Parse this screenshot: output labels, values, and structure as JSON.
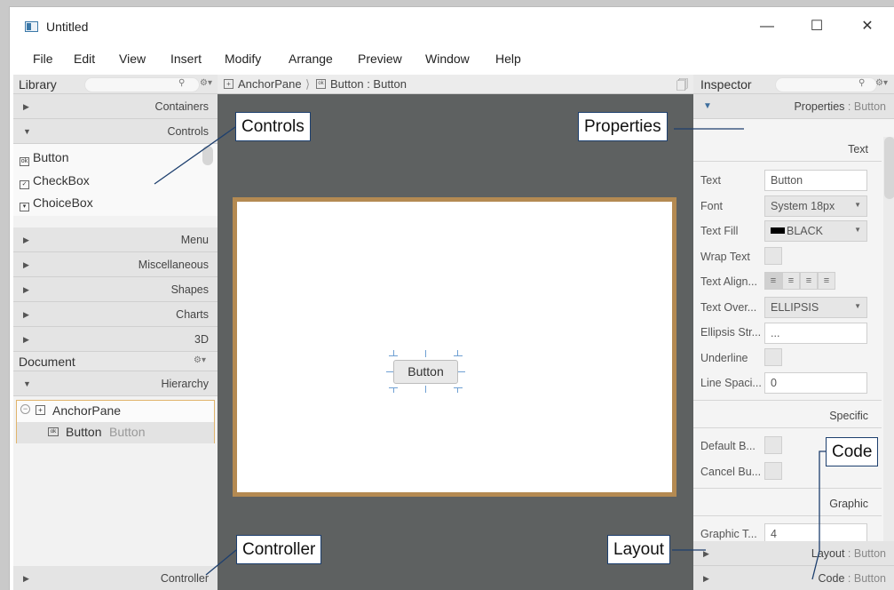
{
  "window": {
    "title": "Untitled",
    "controls": {
      "minimize": "—",
      "maximize": "☐",
      "close": "✕"
    }
  },
  "menu": [
    "File",
    "Edit",
    "View",
    "Insert",
    "Modify",
    "Arrange",
    "Preview",
    "Window",
    "Help"
  ],
  "library": {
    "title": "Library",
    "search_icon": "search-icon",
    "sections": [
      "Containers",
      "Controls",
      "Menu",
      "Miscellaneous",
      "Shapes",
      "Charts",
      "3D"
    ],
    "controls_items": [
      "Button",
      "CheckBox",
      "ChoiceBox"
    ]
  },
  "document": {
    "title": "Document",
    "hierarchy_label": "Hierarchy",
    "tree": [
      {
        "label": "AnchorPane",
        "sub": ""
      },
      {
        "label": "Button",
        "sub": "Button"
      }
    ],
    "controller_label": "Controller"
  },
  "breadcrumb": {
    "parent": "AnchorPane",
    "child": "Button : Button"
  },
  "canvas": {
    "button_label": "Button"
  },
  "inspector": {
    "title": "Inspector",
    "properties_label": "Properties",
    "properties_sub": ": Button",
    "section_text": "Text",
    "section_specific": "Specific",
    "section_graphic": "Graphic",
    "props": {
      "text_label": "Text",
      "text_value": "Button",
      "font_label": "Font",
      "font_value": "System 18px",
      "fill_label": "Text Fill",
      "fill_value": "BLACK",
      "wrap_label": "Wrap Text",
      "align_label": "Text Align...",
      "overrun_label": "Text Over...",
      "overrun_value": "ELLIPSIS",
      "ellipsis_label": "Ellipsis Str...",
      "ellipsis_value": "...",
      "underline_label": "Underline",
      "spacing_label": "Line Spaci...",
      "spacing_value": "0",
      "default_label": "Default B...",
      "cancel_label": "Cancel Bu...",
      "graphic_label": "Graphic T...",
      "graphic_value": "4"
    },
    "layout_label": "Layout",
    "layout_sub": ": Button",
    "code_label": "Code",
    "code_sub": ": Button"
  },
  "callouts": {
    "controls": "Controls",
    "properties": "Properties",
    "code": "Code",
    "controller": "Controller",
    "layout": "Layout"
  },
  "colors": {
    "canvas_border": "#b48a52",
    "stage_bg": "#5e6161",
    "callout_line": "#1d3f6e",
    "selection_border": "#e0b46c"
  }
}
